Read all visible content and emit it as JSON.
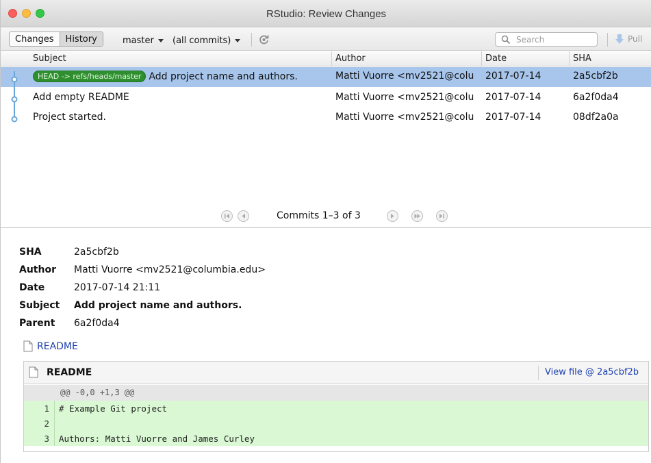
{
  "window": {
    "title": "RStudio: Review Changes"
  },
  "toolbar": {
    "changes_label": "Changes",
    "history_label": "History",
    "branch": "master",
    "commits_filter": "(all commits)",
    "search_placeholder": "Search",
    "pull_label": "Pull"
  },
  "commits": {
    "columns": [
      "Subject",
      "Author",
      "Date",
      "SHA"
    ],
    "rows": [
      {
        "badge": "HEAD -> refs/heads/master",
        "subject": "Add project name and authors.",
        "author": "Matti Vuorre <mv2521@colu",
        "date": "2017-07-14",
        "sha": "2a5cbf2b",
        "selected": true
      },
      {
        "badge": "",
        "subject": "Add empty README",
        "author": "Matti Vuorre <mv2521@colu",
        "date": "2017-07-14",
        "sha": "6a2f0da4",
        "selected": false
      },
      {
        "badge": "",
        "subject": "Project started.",
        "author": "Matti Vuorre <mv2521@colu",
        "date": "2017-07-14",
        "sha": "08df2a0a",
        "selected": false
      }
    ],
    "pager_text": "Commits 1–3 of 3"
  },
  "details": {
    "sha_label": "SHA",
    "sha": "2a5cbf2b",
    "author_label": "Author",
    "author": "Matti Vuorre <mv2521@columbia.edu>",
    "date_label": "Date",
    "date": "2017-07-14 21:11",
    "subject_label": "Subject",
    "subject": "Add project name and authors.",
    "parent_label": "Parent",
    "parent": "6a2f0da4",
    "file_link": "README"
  },
  "diff": {
    "filename": "README",
    "view_file": "View file @ 2a5cbf2b",
    "hunk": "@@ -0,0 +1,3 @@",
    "lines": [
      {
        "num": "1",
        "text": "# Example Git project"
      },
      {
        "num": "2",
        "text": ""
      },
      {
        "num": "3",
        "text": "Authors: Matti Vuorre and James Curley"
      }
    ]
  },
  "colors": {
    "selected_row": "#a8c6ec",
    "branch_badge": "#2f8f2f",
    "added_line": "#d9f8d3",
    "link": "#1d3fb0",
    "graph": "#6aa6d8"
  },
  "icons": [
    "refresh-icon",
    "search-icon",
    "pull-icon",
    "first-page-icon",
    "prev-page-icon",
    "next-page-icon",
    "fast-forward-icon",
    "last-page-icon",
    "file-icon"
  ]
}
